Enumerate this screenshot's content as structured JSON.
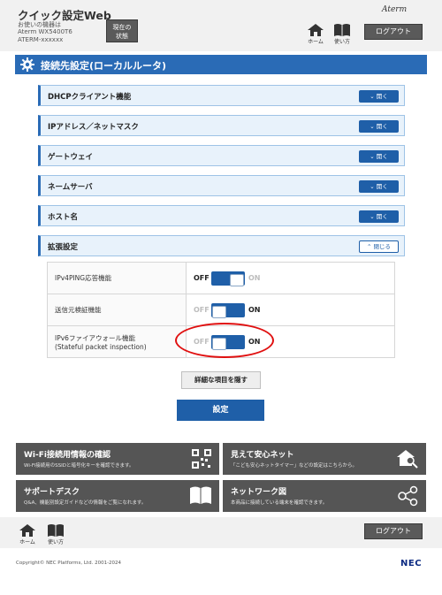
{
  "header": {
    "title": "クイック設定Web",
    "device_label": "お使いの機器は",
    "device_model": "Aterm WX5400T6",
    "device_id": "ATERM-xxxxxx",
    "status_button": [
      "現在の",
      "状態"
    ],
    "brand": "Aterm",
    "home_label": "ホーム",
    "help_label": "使い方",
    "logout_label": "ログアウト"
  },
  "section": {
    "title": "接続先設定(ローカルルータ)"
  },
  "accordion": {
    "open_label": "開く",
    "close_label": "閉じる",
    "items": [
      {
        "label": "DHCPクライアント機能"
      },
      {
        "label": "IPアドレス／ネットマスク"
      },
      {
        "label": "ゲートウェイ"
      },
      {
        "label": "ネームサーバ"
      },
      {
        "label": "ホスト名"
      },
      {
        "label": "拡張設定"
      }
    ]
  },
  "extended": {
    "off_label": "OFF",
    "on_label": "ON",
    "rows": [
      {
        "label": [
          "IPv4PING応答機能"
        ],
        "state": "OFF"
      },
      {
        "label": [
          "送信元検証機能"
        ],
        "state": "ON"
      },
      {
        "label": [
          "IPv6ファイアウォール機能",
          "(Stateful packet inspection)"
        ],
        "state": "ON"
      }
    ]
  },
  "buttons": {
    "hide_details": "詳細な項目を隠す",
    "submit": "設定"
  },
  "tiles": [
    {
      "title": "Wi-Fi接続用情報の確認",
      "desc": "Wi-Fi接続用のSSIDと暗号化キーを確認できます。",
      "icon": "qr-code-icon"
    },
    {
      "title": "見えて安心ネット",
      "desc": "「こども安心ネットタイマー」などの設定はこちらから。",
      "icon": "home-search-icon"
    },
    {
      "title": "サポートデスク",
      "desc": "Q&A、機能別設定ガイドなどの情報をご覧になれます。",
      "icon": "book-icon"
    },
    {
      "title": "ネットワーク図",
      "desc": "本商品に接続している端末を確認できます。",
      "icon": "network-icon"
    }
  ],
  "footer": {
    "home_label": "ホーム",
    "help_label": "使い方",
    "logout_label": "ログアウト",
    "copyright": "Copyright© NEC Platforms, Ltd. 2001-2024",
    "brand": "NEC"
  },
  "colors": {
    "primary": "#2a6bb6",
    "button_dark": "#5a5a5a",
    "highlight": "#e01010"
  }
}
